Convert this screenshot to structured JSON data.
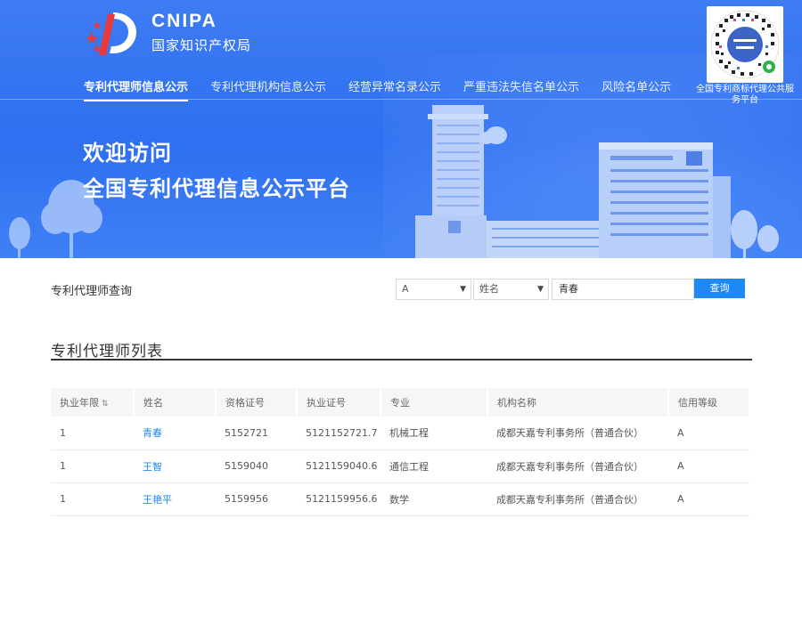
{
  "header": {
    "brand_en": "CNIPA",
    "brand_cn": "国家知识产权局",
    "nav": [
      {
        "label": "专利代理师信息公示",
        "active": true
      },
      {
        "label": "专利代理机构信息公示",
        "active": false
      },
      {
        "label": "经营异常名录公示",
        "active": false
      },
      {
        "label": "严重违法失信名单公示",
        "active": false
      },
      {
        "label": "风险名单公示",
        "active": false
      }
    ],
    "qr_caption": "全国专利商标代理公共服务平台"
  },
  "banner": {
    "welcome_line1": "欢迎访问",
    "welcome_line2": "全国专利代理信息公示平台"
  },
  "search": {
    "title": "专利代理师查询",
    "select1_value": "A",
    "select2_value": "姓名",
    "input_value": "青春",
    "button_label": "查询"
  },
  "list": {
    "title": "专利代理师列表",
    "columns": [
      "执业年限",
      "姓名",
      "资格证号",
      "执业证号",
      "专业",
      "机构名称",
      "信用等级"
    ],
    "rows": [
      [
        "1",
        "青春",
        "5152721",
        "5121152721.7",
        "机械工程",
        "成都天嘉专利事务所（普通合伙）",
        "A"
      ],
      [
        "1",
        "王智",
        "5159040",
        "5121159040.6",
        "通信工程",
        "成都天嘉专利事务所（普通合伙）",
        "A"
      ],
      [
        "1",
        "王艳平",
        "5159956",
        "5121159956.6",
        "数学",
        "成都天嘉专利事务所（普通合伙）",
        "A"
      ]
    ]
  },
  "colors": {
    "banner_blue": "#3075f0",
    "link_blue": "#1e88f5",
    "button_blue": "#1e88f5"
  }
}
